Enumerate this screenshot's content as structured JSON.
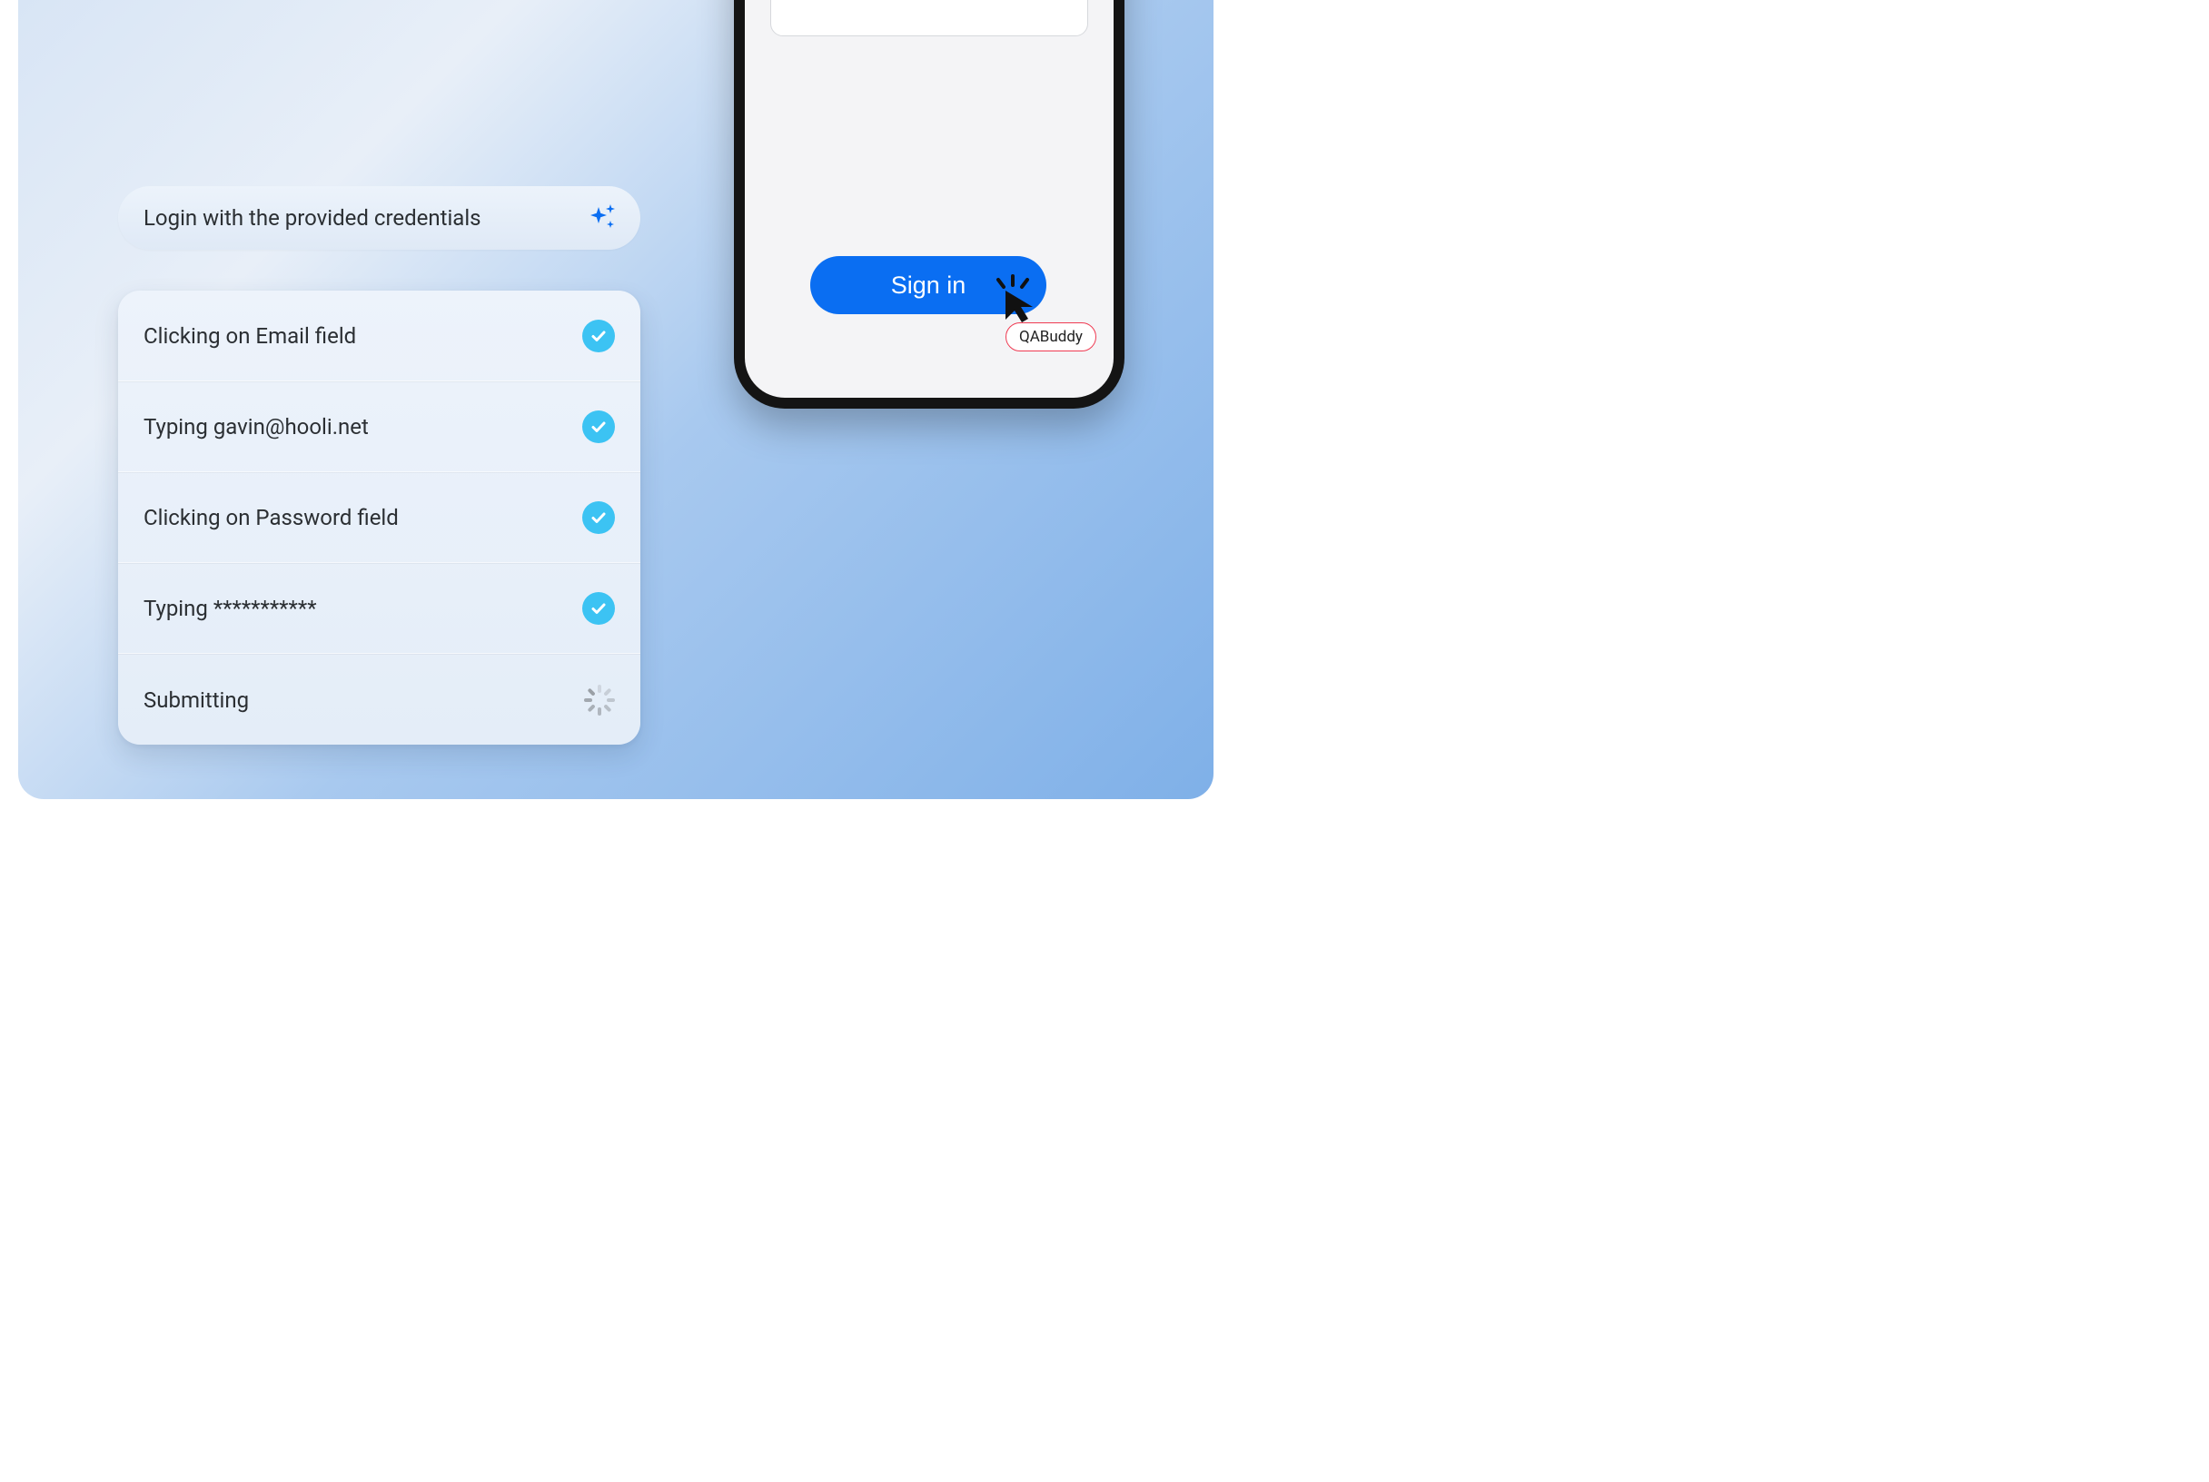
{
  "prompt": {
    "text": "Login with the provided credentials"
  },
  "steps": [
    {
      "label": "Clicking on Email field",
      "status": "done"
    },
    {
      "label": "Typing gavin@hooli.net",
      "status": "done"
    },
    {
      "label": "Clicking on Password field",
      "status": "done"
    },
    {
      "label": "Typing ***********",
      "status": "done"
    },
    {
      "label": "Submitting",
      "status": "in_progress"
    }
  ],
  "phone": {
    "signin_label": "Sign in"
  },
  "agent_tag": "QABuddy",
  "colors": {
    "accent_blue": "#0A6EF2",
    "check_cyan": "#3CC3F3",
    "tag_border": "#ef3a52"
  }
}
